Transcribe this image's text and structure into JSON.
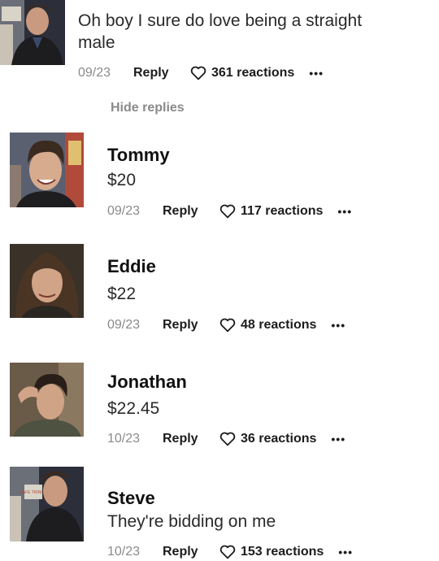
{
  "top_comment": {
    "text": "Oh boy I sure do love being a straight male",
    "date": "09/23",
    "reply_label": "Reply",
    "reactions": "361 reactions",
    "more": "•••"
  },
  "hide_replies_label": "Hide replies",
  "replies": [
    {
      "name": "Tommy",
      "text": "$20",
      "date": "09/23",
      "reply_label": "Reply",
      "reactions": "117 reactions",
      "more": "•••"
    },
    {
      "name": "Eddie",
      "text": "$22",
      "date": "09/23",
      "reply_label": "Reply",
      "reactions": "48 reactions",
      "more": "•••"
    },
    {
      "name": "Jonathan",
      "text": "$22.45",
      "date": "10/23",
      "reply_label": "Reply",
      "reactions": "36 reactions",
      "more": "•••"
    },
    {
      "name": "Steve",
      "text": "They're bidding on me",
      "date": "10/23",
      "reply_label": "Reply",
      "reactions": "153 reactions",
      "more": "•••"
    }
  ],
  "avatar_sign_text": "SAFE TRINGS",
  "colors": {
    "meta_gray": "#8a8a8a",
    "text_dark": "#1c1c1c"
  }
}
